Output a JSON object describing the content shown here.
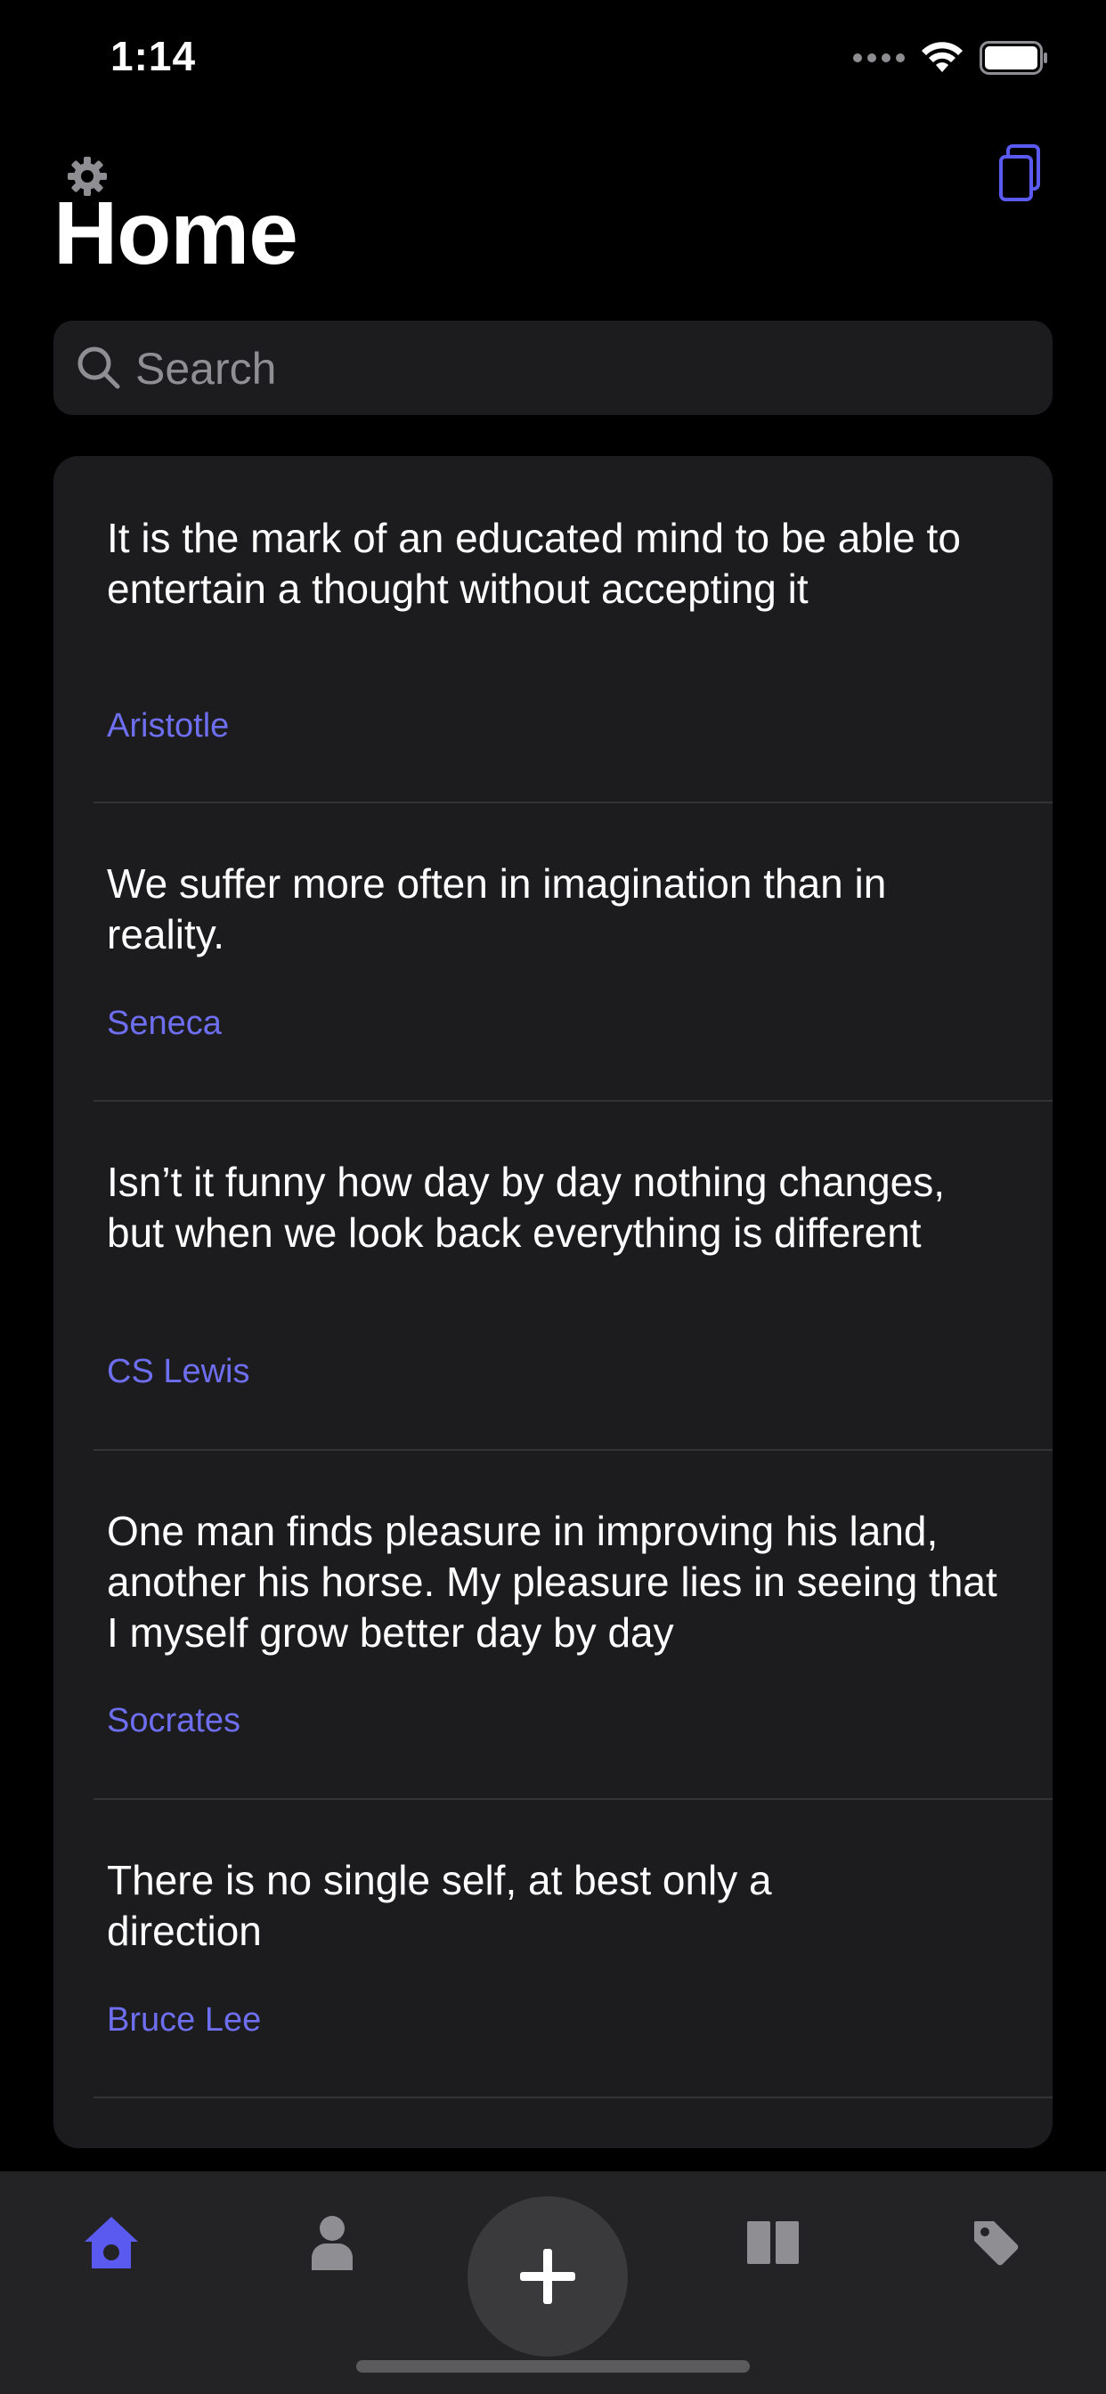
{
  "status_bar": {
    "time": "1:14"
  },
  "header": {
    "title": "Home"
  },
  "search": {
    "placeholder": "Search"
  },
  "quotes": [
    {
      "text": "It is the mark of an educated mind to be able to entertain a thought without accepting it",
      "author": "Aristotle"
    },
    {
      "text": "We suffer more often in imagination than in reality.",
      "author": "Seneca"
    },
    {
      "text": "Isn’t it funny how day by day nothing changes, but when we look back everything is different",
      "author": "CS Lewis"
    },
    {
      "text": "One man finds pleasure in improving his land, another his horse. My pleasure lies in seeing that I myself grow better day by day",
      "author": "Socrates"
    },
    {
      "text": "There is no single self, at best only a direction",
      "author": "Bruce Lee"
    }
  ],
  "tab_bar": {
    "items": [
      "home-icon",
      "person-icon",
      "add-icon",
      "book-icon",
      "tag-icon"
    ],
    "active": "home-icon"
  },
  "colors": {
    "accent": "#6e6ef0",
    "background": "#000000",
    "card": "#1c1c1e",
    "tab_bar": "#232325"
  }
}
